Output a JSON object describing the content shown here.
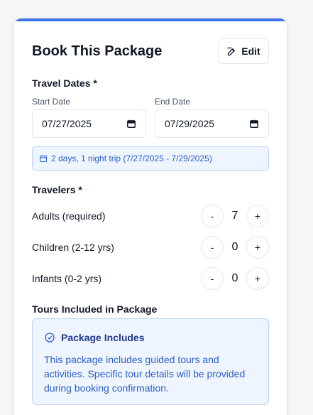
{
  "card": {
    "title": "Book This Package",
    "edit_label": "Edit",
    "accent": "#3b74e6"
  },
  "travel_dates": {
    "section_label": "Travel Dates *",
    "start": {
      "label": "Start Date",
      "value": "07/27/2025",
      "icon": "calendar-icon"
    },
    "end": {
      "label": "End Date",
      "value": "07/29/2025",
      "icon": "calendar-icon"
    },
    "summary": "2 days, 1 night trip (7/27/2025 - 7/29/2025)"
  },
  "travelers": {
    "section_label": "Travelers *",
    "rows": [
      {
        "label": "Adults (required)",
        "value": "7",
        "minus": "-",
        "plus": "+"
      },
      {
        "label": "Children (2-12 yrs)",
        "value": "0",
        "minus": "-",
        "plus": "+"
      },
      {
        "label": "Infants (0-2 yrs)",
        "value": "0",
        "minus": "-",
        "plus": "+"
      }
    ]
  },
  "tours": {
    "section_label": "Tours Included in Package",
    "box_title": "Package Includes",
    "box_text": "This package includes guided tours and activities. Specific tour details will be provided during booking confirmation.",
    "icon": "check-circle-icon"
  }
}
